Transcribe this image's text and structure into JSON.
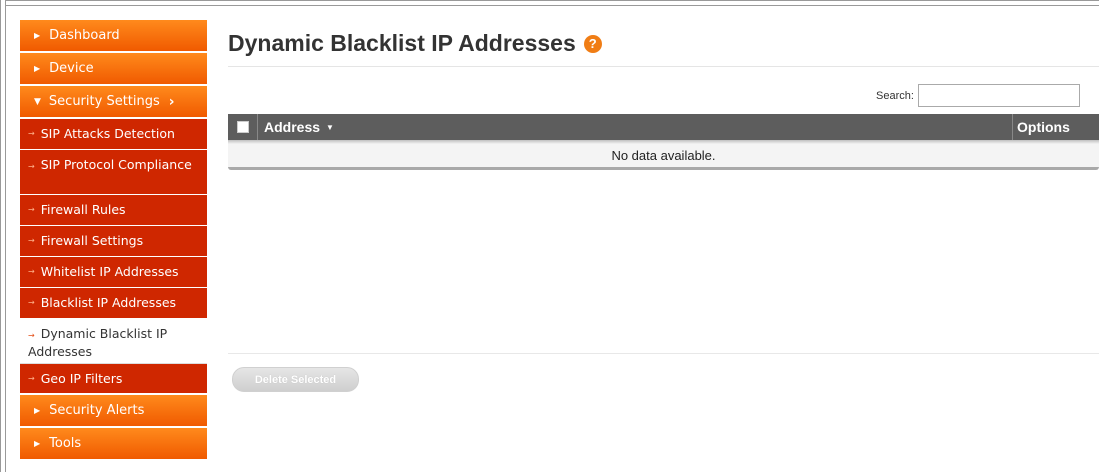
{
  "sidebar": {
    "dashboard": "Dashboard",
    "device": "Device",
    "security_settings": "Security Settings",
    "sub_items": [
      "SIP Attacks Detection",
      "SIP Protocol Compliance",
      "Firewall Rules",
      "Firewall Settings",
      "Whitelist IP Addresses",
      "Blacklist IP Addresses",
      "Dynamic Blacklist IP Addresses",
      "Geo IP Filters"
    ],
    "security_alerts": "Security Alerts",
    "tools": "Tools"
  },
  "main": {
    "title": "Dynamic Blacklist IP Addresses",
    "help_glyph": "?",
    "search_label": "Search:",
    "search_value": "",
    "table": {
      "col_address": "Address",
      "col_options": "Options",
      "empty_text": "No data available."
    },
    "delete_selected": "Delete Selected"
  },
  "colors": {
    "nav_orange": "#f26a0a",
    "nav_red": "#cf2700",
    "table_header": "#5d5d5d",
    "help_icon": "#f07d15"
  }
}
